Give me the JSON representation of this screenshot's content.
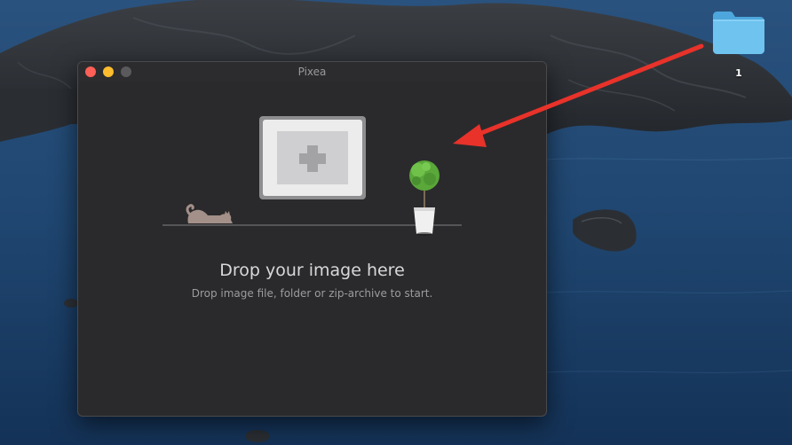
{
  "window": {
    "title": "Pixea"
  },
  "drop_zone": {
    "title": "Drop your image here",
    "subtitle": "Drop image file, folder or zip-archive to start."
  },
  "desktop": {
    "folder_label": "1"
  },
  "colors": {
    "close": "#fe5f57",
    "minimize": "#febc2e",
    "maximize": "#5a5a5c",
    "arrow": "#e8322a",
    "folder": "#5bb4e6"
  }
}
